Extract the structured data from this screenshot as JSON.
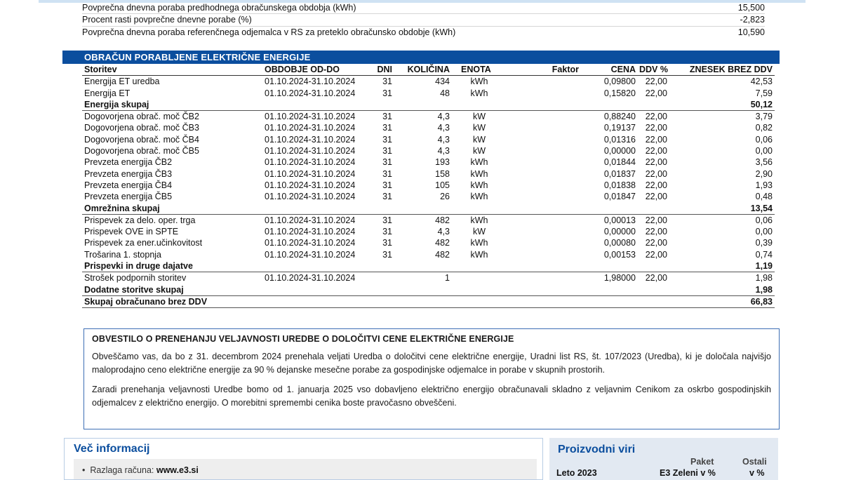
{
  "summary_rows": [
    {
      "label": "Povprečna dnevna poraba predhodnega obračunskega obdobja (kWh)",
      "value": "15,500"
    },
    {
      "label": "Procent rasti povprečne dnevne porabe (%)",
      "value": "-2,823"
    },
    {
      "label": "Povprečna dnevna poraba referenčnega odjemalca v RS za preteklo obračunsko obdobje (kWh)",
      "value": "10,590"
    }
  ],
  "section_title": "OBRAČUN PORABLJENE ELEKTRIČNE ENERGIJE",
  "columns": {
    "service": "Storitev",
    "period": "OBDOBJE OD-DO",
    "days": "DNI",
    "qty": "KOLIČINA",
    "unit": "ENOTA",
    "factor": "Faktor",
    "price": "CENA",
    "ddv": "DDV %",
    "amount": "ZNESEK BREZ DDV"
  },
  "rows": [
    {
      "type": "item",
      "service": "Energija ET uredba",
      "period": "01.10.2024-31.10.2024",
      "days": "31",
      "qty": "434",
      "unit": "kWh",
      "price": "0,09800",
      "ddv": "22,00",
      "amount": "42,53"
    },
    {
      "type": "item",
      "service": "Energija ET",
      "period": "01.10.2024-31.10.2024",
      "days": "31",
      "qty": "48",
      "unit": "kWh",
      "price": "0,15820",
      "ddv": "22,00",
      "amount": "7,59"
    },
    {
      "type": "sum",
      "service": "Energija skupaj",
      "amount": "50,12"
    },
    {
      "type": "item",
      "service": "Dogovorjena obrač. moč ČB2",
      "period": "01.10.2024-31.10.2024",
      "days": "31",
      "qty": "4,3",
      "unit": "kW",
      "price": "0,88240",
      "ddv": "22,00",
      "amount": "3,79"
    },
    {
      "type": "item",
      "service": "Dogovorjena obrač. moč ČB3",
      "period": "01.10.2024-31.10.2024",
      "days": "31",
      "qty": "4,3",
      "unit": "kW",
      "price": "0,19137",
      "ddv": "22,00",
      "amount": "0,82"
    },
    {
      "type": "item",
      "service": "Dogovorjena obrač. moč ČB4",
      "period": "01.10.2024-31.10.2024",
      "days": "31",
      "qty": "4,3",
      "unit": "kW",
      "price": "0,01316",
      "ddv": "22,00",
      "amount": "0,06"
    },
    {
      "type": "item",
      "service": "Dogovorjena obrač. moč ČB5",
      "period": "01.10.2024-31.10.2024",
      "days": "31",
      "qty": "4,3",
      "unit": "kW",
      "price": "0,00000",
      "ddv": "22,00",
      "amount": "0,00"
    },
    {
      "type": "item",
      "service": "Prevzeta energija ČB2",
      "period": "01.10.2024-31.10.2024",
      "days": "31",
      "qty": "193",
      "unit": "kWh",
      "price": "0,01844",
      "ddv": "22,00",
      "amount": "3,56"
    },
    {
      "type": "item",
      "service": "Prevzeta energija ČB3",
      "period": "01.10.2024-31.10.2024",
      "days": "31",
      "qty": "158",
      "unit": "kWh",
      "price": "0,01837",
      "ddv": "22,00",
      "amount": "2,90"
    },
    {
      "type": "item",
      "service": "Prevzeta energija ČB4",
      "period": "01.10.2024-31.10.2024",
      "days": "31",
      "qty": "105",
      "unit": "kWh",
      "price": "0,01838",
      "ddv": "22,00",
      "amount": "1,93"
    },
    {
      "type": "item",
      "service": "Prevzeta energija ČB5",
      "period": "01.10.2024-31.10.2024",
      "days": "31",
      "qty": "26",
      "unit": "kWh",
      "price": "0,01847",
      "ddv": "22,00",
      "amount": "0,48"
    },
    {
      "type": "sum",
      "service": "Omrežnina skupaj",
      "amount": "13,54"
    },
    {
      "type": "item",
      "service": "Prispevek za delo. oper. trga",
      "period": "01.10.2024-31.10.2024",
      "days": "31",
      "qty": "482",
      "unit": "kWh",
      "price": "0,00013",
      "ddv": "22,00",
      "amount": "0,06"
    },
    {
      "type": "item",
      "service": "Prispevek OVE in SPTE",
      "period": "01.10.2024-31.10.2024",
      "days": "31",
      "qty": "4,3",
      "unit": "kW",
      "price": "0,00000",
      "ddv": "22,00",
      "amount": "0,00"
    },
    {
      "type": "item",
      "service": "Prispevek za ener.učinkovitost",
      "period": "01.10.2024-31.10.2024",
      "days": "31",
      "qty": "482",
      "unit": "kWh",
      "price": "0,00080",
      "ddv": "22,00",
      "amount": "0,39"
    },
    {
      "type": "item",
      "service": "Trošarina 1. stopnja",
      "period": "01.10.2024-31.10.2024",
      "days": "31",
      "qty": "482",
      "unit": "kWh",
      "price": "0,00153",
      "ddv": "22,00",
      "amount": "0,74"
    },
    {
      "type": "sum",
      "service": "Prispevki in druge dajatve",
      "amount": "1,19"
    },
    {
      "type": "item",
      "service": "Strošek podpornih storitev",
      "period": "01.10.2024-31.10.2024",
      "days": "",
      "qty": "1",
      "unit": "",
      "price": "1,98000",
      "ddv": "22,00",
      "amount": "1,98"
    },
    {
      "type": "sum",
      "service": "Dodatne storitve skupaj",
      "amount": "1,98"
    },
    {
      "type": "sum",
      "service": "Skupaj obračunano brez DDV",
      "amount": "66,83"
    }
  ],
  "notice": {
    "title": "OBVESTILO O PRENEHANJU VELJAVNOSTI UREDBE O DOLOČITVI CENE ELEKTRIČNE ENERGIJE",
    "p1": "Obveščamo vas, da bo z 31. decembrom 2024 prenehala veljati Uredba o določitvi cene električne energije, Uradni list RS, št. 107/2023 (Uredba), ki je določala najvišjo maloprodajno ceno električne energije za 90 % dejanske mesečne porabe za gospodinjske odjemalce in porabe v skupnih prostorih.",
    "p2": "Zaradi prenehanja veljavnosti Uredbe bomo od 1. januarja 2025 vso dobavljeno električno energijo obračunavali skladno z veljavnim Cenikom za oskrbo gospodinjskih odjemalcev z električno energijo. O morebitni spremembi cenika boste pravočasno obveščeni."
  },
  "more_info": {
    "title": "Več informacij",
    "item_label": "Razlaga računa:",
    "item_link": "www.e3.si"
  },
  "sources": {
    "title": "Proizvodni viri",
    "col_paket": "Paket",
    "col_ostali": "Ostali",
    "row_label": "Leto 2023",
    "row_paket": "E3 Zeleni v %",
    "row_ostali": "v %"
  }
}
